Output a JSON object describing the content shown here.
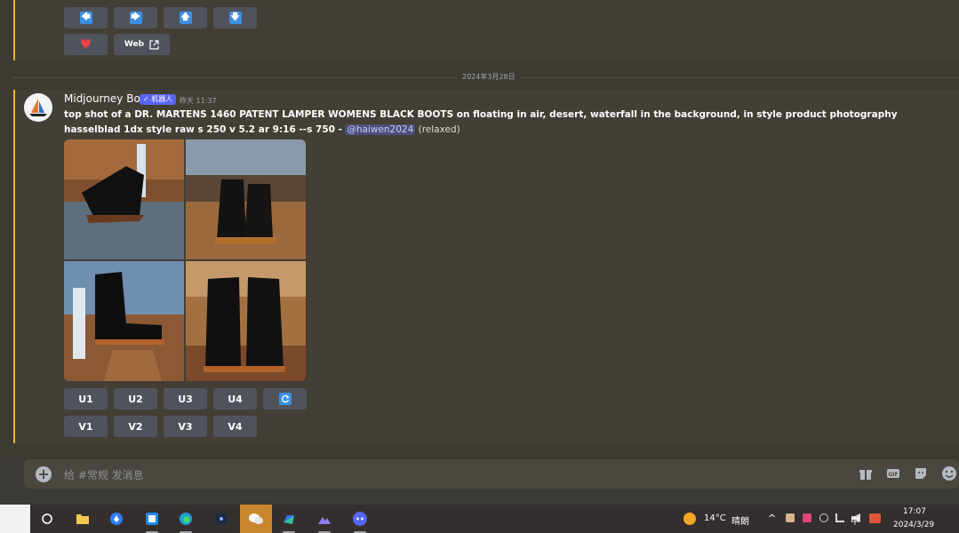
{
  "previous_message": {
    "nav_buttons": [
      {
        "name": "left-arrow-button",
        "glyph": "🡄"
      },
      {
        "name": "right-arrow-button",
        "glyph": "🡆"
      },
      {
        "name": "up-arrow-button",
        "glyph": "🡅"
      },
      {
        "name": "down-arrow-button",
        "glyph": "🡇"
      }
    ],
    "like_glyph": "♥",
    "web_label": "Web"
  },
  "date_divider": "2024年3月28日",
  "message": {
    "author": "Midjourney Bot",
    "badge": "✓ 机器人",
    "time": "昨天 11:37",
    "prompt_bold": "top shot of a DR. MARTENS 1460 PATENT LAMPER WOMENS BLACK BOOTS on floating in air, desert, waterfall in the background, in style product photography hasselblad 1dx style raw s 250 v 5.2 ar 9:16 --s 750 -",
    "mention": "@haiwen2024",
    "status": "(relaxed)"
  },
  "actions": {
    "upscale": [
      "U1",
      "U2",
      "U3",
      "U4"
    ],
    "variation": [
      "V1",
      "V2",
      "V3",
      "V4"
    ]
  },
  "composer": {
    "placeholder": "给 #常规 发消息"
  },
  "taskbar": {
    "weather_temp": "14°C",
    "weather_desc": "晴朗",
    "ime": "中",
    "time": "17:07",
    "date": "2024/3/29"
  },
  "colors": {
    "accent": "#f0b232",
    "brand": "#5865f2",
    "button": "#4f545c",
    "arrow": "#3b8fe0"
  }
}
